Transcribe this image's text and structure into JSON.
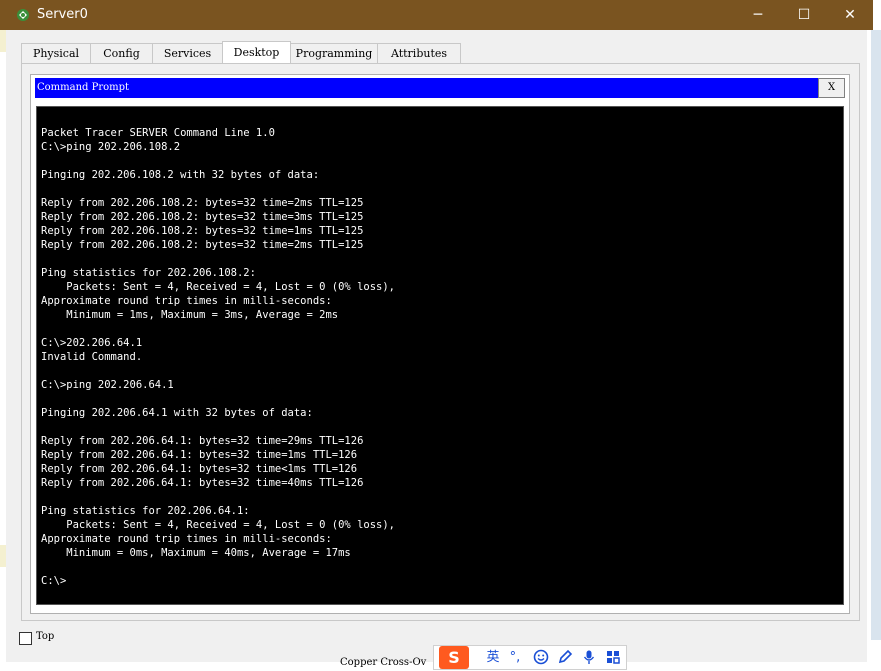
{
  "window": {
    "title": "Server0",
    "minimize": "─",
    "maximize": "☐",
    "close": "✕"
  },
  "tabs": [
    {
      "label": "Physical"
    },
    {
      "label": "Config"
    },
    {
      "label": "Services"
    },
    {
      "label": "Desktop"
    },
    {
      "label": "Programming"
    },
    {
      "label": "Attributes"
    }
  ],
  "active_tab": "Desktop",
  "command_prompt": {
    "title": "Command Prompt",
    "close_label": "X",
    "output": "Packet Tracer SERVER Command Line 1.0\nC:\\>ping 202.206.108.2\n\nPinging 202.206.108.2 with 32 bytes of data:\n\nReply from 202.206.108.2: bytes=32 time=2ms TTL=125\nReply from 202.206.108.2: bytes=32 time=3ms TTL=125\nReply from 202.206.108.2: bytes=32 time=1ms TTL=125\nReply from 202.206.108.2: bytes=32 time=2ms TTL=125\n\nPing statistics for 202.206.108.2:\n    Packets: Sent = 4, Received = 4, Lost = 0 (0% loss),\nApproximate round trip times in milli-seconds:\n    Minimum = 1ms, Maximum = 3ms, Average = 2ms\n\nC:\\>202.206.64.1\nInvalid Command.\n\nC:\\>ping 202.206.64.1\n\nPinging 202.206.64.1 with 32 bytes of data:\n\nReply from 202.206.64.1: bytes=32 time=29ms TTL=126\nReply from 202.206.64.1: bytes=32 time=1ms TTL=126\nReply from 202.206.64.1: bytes=32 time<1ms TTL=126\nReply from 202.206.64.1: bytes=32 time=40ms TTL=126\n\nPing statistics for 202.206.64.1:\n    Packets: Sent = 4, Received = 4, Lost = 0 (0% loss),\nApproximate round trip times in milli-seconds:\n    Minimum = 0ms, Maximum = 40ms, Average = 17ms\n\nC:\\>"
  },
  "footer": {
    "top_label": "Top",
    "top_checked": false
  },
  "background": {
    "cable_text": "Copper Cross-Ov"
  },
  "ime": {
    "logo": "S",
    "lang": "英",
    "punct": "°,",
    "emoji_icon": "smile-icon",
    "pen_icon": "pen-icon",
    "mic_icon": "microphone-icon",
    "grid_icon": "grid-icon"
  },
  "colors": {
    "titlebar": "#7a5420",
    "cmd_header": "#0000ff",
    "terminal_bg": "#000000",
    "terminal_fg": "#ffffff"
  }
}
